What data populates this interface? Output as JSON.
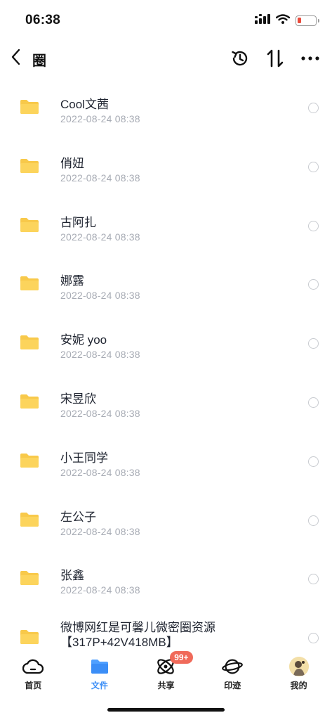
{
  "status_bar": {
    "time": "06:38",
    "battery_level": 0.2,
    "battery_color": "#e94b3c"
  },
  "nav": {
    "title": "圈",
    "icons": [
      "back-chevron-icon",
      "history-icon",
      "sort-icon",
      "more-icon"
    ]
  },
  "files": [
    {
      "name": "Cool文茜",
      "date": "2022-08-24 08:38"
    },
    {
      "name": "俏妞",
      "date": "2022-08-24 08:38"
    },
    {
      "name": "古阿扎",
      "date": "2022-08-24 08:38"
    },
    {
      "name": "娜露",
      "date": "2022-08-24 08:38"
    },
    {
      "name": "安妮 yoo",
      "date": "2022-08-24 08:38"
    },
    {
      "name": "宋昱欣",
      "date": "2022-08-24 08:38"
    },
    {
      "name": "小王同学",
      "date": "2022-08-24 08:38"
    },
    {
      "name": "左公子",
      "date": "2022-08-24 08:38"
    },
    {
      "name": "张鑫",
      "date": "2022-08-24 08:38"
    },
    {
      "name": "微博网红是可馨儿微密圈资源【317P+42V418MB】",
      "date": ""
    }
  ],
  "tabs": [
    {
      "label": "首页",
      "icon": "cloud-icon",
      "active": false
    },
    {
      "label": "文件",
      "icon": "folder-icon",
      "active": true
    },
    {
      "label": "共享",
      "icon": "orbit-icon",
      "active": false,
      "badge": "99+"
    },
    {
      "label": "印迹",
      "icon": "planet-icon",
      "active": false
    },
    {
      "label": "我的",
      "icon": "avatar-icon",
      "active": false
    }
  ],
  "colors": {
    "accent": "#3b8ef7",
    "folder": "#fcd45c",
    "badge": "#f06a5a"
  }
}
